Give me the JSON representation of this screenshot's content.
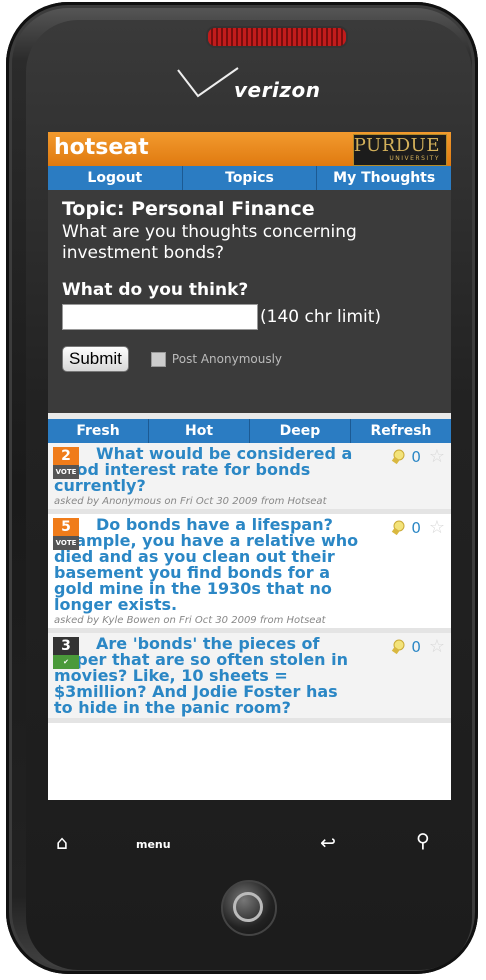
{
  "device": {
    "brand": "verizon",
    "buttons": {
      "home": "home-icon",
      "menu": "menu",
      "back": "back-icon",
      "search": "search-icon"
    }
  },
  "app": {
    "logo": "hotseat",
    "university": "PURDUE",
    "university_sub": "UNIVERSITY",
    "nav": [
      "Logout",
      "Topics",
      "My Thoughts"
    ]
  },
  "topic": {
    "title": "Topic: Personal Finance",
    "question": "What are you thoughts concerning investment bonds?"
  },
  "form": {
    "prompt": "What do you think?",
    "input_value": "",
    "limit": "(140 chr limit)",
    "submit": "Submit",
    "anonymous": "Post Anonymously",
    "anonymous_checked": false
  },
  "tabs": [
    "Fresh",
    "Hot",
    "Deep",
    "Refresh"
  ],
  "posts": [
    {
      "votes": "2",
      "vote_label": "VOTE",
      "vote_color": "#f07c1a",
      "text": "What would be considered a good interest rate for bonds currently?",
      "meta": "asked by Anonymous on Fri Oct 30 2009 from Hotseat",
      "count": "0"
    },
    {
      "votes": "5",
      "vote_label": "VOTE",
      "vote_color": "#f07c1a",
      "text": "Do bonds have a lifespan? Example, you have a relative who died and as you clean out their basement you find bonds for a gold mine in the 1930s that no longer exists.",
      "meta": "asked by Kyle Bowen on Fri Oct 30 2009 from Hotseat",
      "count": "0"
    },
    {
      "votes": "3",
      "vote_label": "",
      "vote_color": "#333333",
      "text": "Are 'bonds' the pieces of paper that are so often stolen in movies? Like, 10 sheets = $3million? And Jodie Foster has to hide in the panic room?",
      "meta": "",
      "count": "0"
    }
  ],
  "colors": {
    "accent": "#2b87c5",
    "header": "#e88a1f",
    "nav": "#2b7cc2"
  }
}
